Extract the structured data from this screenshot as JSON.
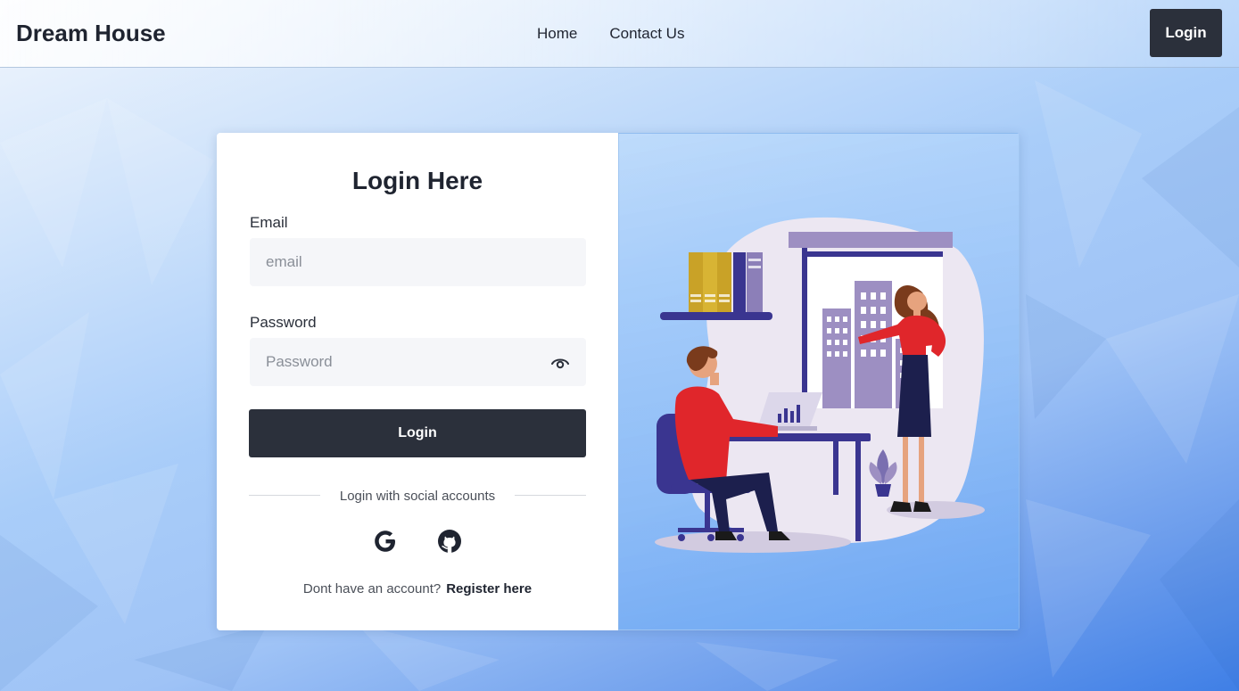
{
  "navbar": {
    "brand": "Dream House",
    "links": [
      "Home",
      "Contact Us"
    ],
    "login_button": "Login"
  },
  "login_form": {
    "title": "Login Here",
    "email_label": "Email",
    "email_placeholder": "email",
    "password_label": "Password",
    "password_placeholder": "Password",
    "password_toggle_icon": "eye-icon",
    "submit_label": "Login",
    "social_divider_text": "Login with social accounts",
    "social_icons": [
      "google-icon",
      "github-icon"
    ],
    "register_prompt": "Dont have an account?",
    "register_link": "Register here"
  },
  "colors": {
    "dark_button": "#2b303b",
    "input_bg": "#f5f6f9",
    "accent_red": "#e0262b",
    "accent_purple": "#3a3590"
  }
}
